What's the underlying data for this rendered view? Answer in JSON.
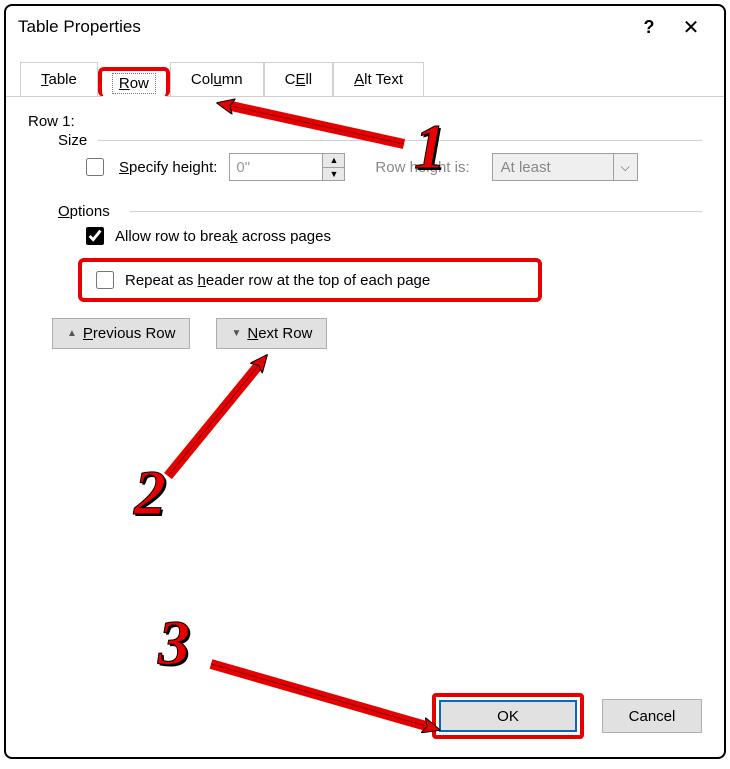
{
  "title": "Table Properties",
  "tabs": {
    "table_u": "T",
    "table_rest": "able",
    "row_u": "R",
    "row_rest": "ow",
    "column_u": "u",
    "column_pre": "Col",
    "column_post": "mn",
    "cell_u": "E",
    "cell_pre": "C",
    "cell_post": "ll",
    "alttext_u": "A",
    "alttext_rest": "lt Text"
  },
  "row_label": "Row 1:",
  "size_legend": "Size",
  "specify_u": "S",
  "specify_rest": "pecify height:",
  "specify_value": "0\"",
  "row_height_is": "Row height is:",
  "dropdown_value": "At least",
  "options_legend_u": "O",
  "options_legend_rest": "ptions",
  "allow_break_u": "K",
  "allow_break_pre": "Allow row to brea",
  "allow_break_post": " across pages",
  "repeat_u": "h",
  "repeat_pre": "Repeat as ",
  "repeat_post": "eader row at the top of each page",
  "prev_row_u": "P",
  "prev_row_rest": "revious Row",
  "next_row_u": "N",
  "next_row_rest": "ext Row",
  "ok_label": "OK",
  "cancel_label": "Cancel",
  "annotations": {
    "n1": "1",
    "n2": "2",
    "n3": "3"
  }
}
